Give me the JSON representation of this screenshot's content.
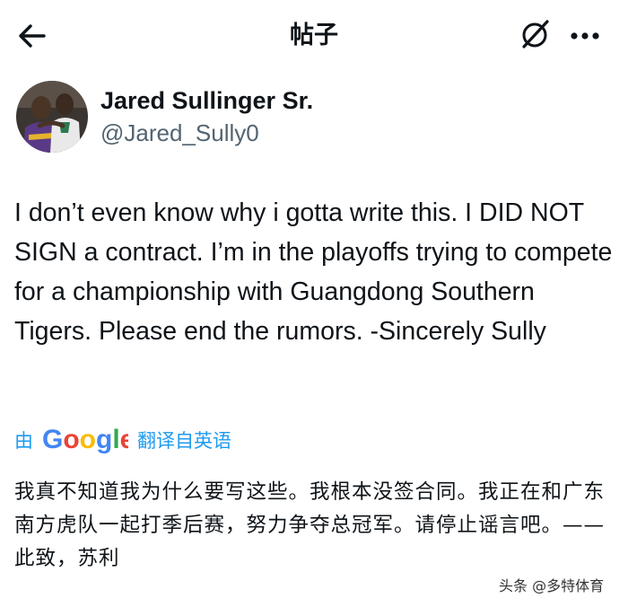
{
  "header": {
    "title": "帖子",
    "icons": {
      "back": "arrow-left-icon",
      "grok": "grok-slash-icon",
      "more": "more-horizontal-icon"
    }
  },
  "author": {
    "display_name": "Jared Sullinger Sr.",
    "handle": "@Jared_Sully0"
  },
  "post": {
    "text": "I don’t even know why i gotta write this. I DID NOT SIGN a contract. I’m in the playoffs trying to compete for a championship with Guangdong Southern Tigers. Please end the rumors. -Sincerely Sully"
  },
  "translation_notice": {
    "prefix": "由",
    "provider": "Google",
    "suffix": "翻译自英语",
    "accent_color": "#1d9bf0"
  },
  "translation": {
    "text": "我真不知道我为什么要写这些。我根本没签合同。我正在和广东南方虎队一起打季后赛，努力争夺总冠军。请停止谣言吧。——此致，苏利"
  },
  "watermark": {
    "text": "头条 @多特体育"
  }
}
